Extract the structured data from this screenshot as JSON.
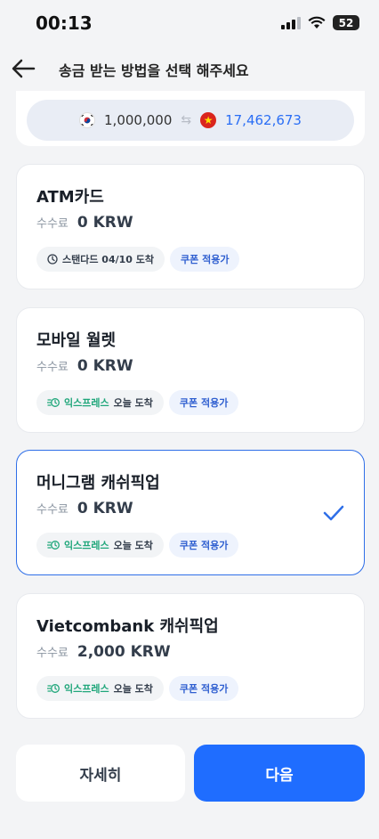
{
  "status_bar": {
    "time": "00:13",
    "battery": "52"
  },
  "header": {
    "title": "송금 받는 방법을 선택 해주세요"
  },
  "rate": {
    "send_amount": "1,000,000",
    "receive_amount": "17,462,673",
    "send_flag": "korea-flag-icon",
    "receive_flag": "vietnam-flag-icon"
  },
  "methods": [
    {
      "name": "ATM카드",
      "fee_label": "수수료",
      "fee_value": "0 KRW",
      "speed_label": "스탠다드 04/10 도착",
      "coupon_label": "쿠폰 적용가"
    },
    {
      "name": "모바일 월렛",
      "fee_label": "수수료",
      "fee_value": "0 KRW",
      "speed_label_accent": "익스프레스",
      "speed_label_rest": "오늘 도착",
      "coupon_label": "쿠폰 적용가"
    },
    {
      "name": "머니그램 캐쉬픽업",
      "fee_label": "수수료",
      "fee_value": "0 KRW",
      "speed_label_accent": "익스프레스",
      "speed_label_rest": "오늘 도착",
      "coupon_label": "쿠폰 적용가"
    },
    {
      "name": "Vietcombank 캐쉬픽업",
      "fee_label": "수수료",
      "fee_value": "2,000 KRW",
      "speed_label_accent": "익스프레스",
      "speed_label_rest": "오늘 도착",
      "coupon_label": "쿠폰 적용가"
    }
  ],
  "selected_method_index": 2,
  "buttons": {
    "detail": "자세히",
    "next": "다음"
  },
  "colors": {
    "accent": "#1f6dff",
    "express": "#1fa67a",
    "selected_border": "#2f6fe8"
  }
}
